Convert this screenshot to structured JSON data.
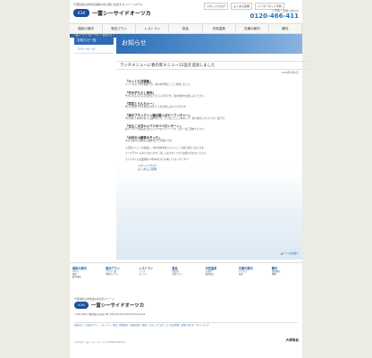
{
  "header": {
    "tagline": "千葉県館山市布良海岸の中心部に位置するリゾートホテル",
    "logo_mark": "ICHI",
    "logo_name": "一富シーサイドオーツカ",
    "links": [
      "スタッフブログ",
      "よくある質問",
      "インターネット予約"
    ],
    "tel_label": "ご予約・お問い合わせ",
    "tel": "0120-466-411"
  },
  "nav": [
    "施設の案内",
    "宿泊プラン",
    "レストラン",
    "宴会",
    "天然温泉",
    "交通の案内",
    "観光"
  ],
  "breadcrumb": "一富シーサイドオーツカ ＞ お知らせ ＞ ランチメニューに春の新メニュー12品を追加しました",
  "sidebar": {
    "active": "お知らせ一覧",
    "item": "フリーページ"
  },
  "hero": {
    "title": "お知らせ"
  },
  "article": {
    "title": "ランチメニューに春の新メニュー12品を追加しました",
    "date": "2014年4月1日",
    "items": [
      {
        "title": "「カットち豆御飯」",
        "desc": "カットち豆で作る御飯です。春のお料理としてご用意しました。"
      },
      {
        "title": "「竹の子ちらし寿司」",
        "desc": "竹の子をふんだんに使用したちらし寿司です。春の味覚をお楽しみください。"
      },
      {
        "title": "「菜花とうんちゃー」",
        "desc": "地元の野菜で作る菜花のおひたしをお楽しみいただけます。"
      },
      {
        "title": "「海のプランクトン麺の酸っぱビーフンチャー」",
        "desc": "海で採れた素材を使った麺料理です。さっぱりとした味わいで、春の食卓にぴったりの一品です。"
      },
      {
        "title": "「仕込こま甘キャベツのペペロンチーノ」",
        "desc": "春キャベツの甘みを活かしたペペロンチーノです。ぜひ一度ご賞味ください。"
      },
      {
        "title": "「木村の小鯵茶のぞっち」",
        "desc": "木村で採れた新鮮な小鯵を使った茶漬けです。"
      }
    ],
    "note1": "上記新メニューの追加に、旬の食材を使ったメニューも取り揃えております。",
    "note2": "テイクアウトも承っております。詳しくはスタッフまでお問い合わせください。",
    "contact": "ランチタイム営業時間 11時30分から14時（ラストオーダー）",
    "links": [
      "スタッフブログ",
      "よくあるご質問"
    ],
    "pagetop": "▲ページの先頭へ"
  },
  "footer": {
    "cols": [
      {
        "title": "施設の案内",
        "subs": [
          "ホテル",
          "客室",
          "館内施設"
        ]
      },
      {
        "title": "宿泊プラン",
        "subs": [
          "プラン一覧",
          "季節のプラン"
        ]
      },
      {
        "title": "レストラン",
        "subs": [
          "ランチ",
          "ディナー"
        ]
      },
      {
        "title": "宴会",
        "subs": [
          "宴会場",
          "宴会プラン"
        ]
      },
      {
        "title": "天然温泉",
        "subs": [
          "大浴場",
          "露天風呂"
        ]
      },
      {
        "title": "交通の案内",
        "subs": [
          "アクセス",
          "送迎"
        ]
      },
      {
        "title": "観光",
        "subs": [
          "周辺観光",
          "体験"
        ]
      }
    ],
    "tagline": "千葉県館山市布良の海辺のリゾート",
    "logo_mark": "ICHI",
    "logo_name": "一富シーサイドオーツカ",
    "address": "〒294-0234 千葉県館山市布良 TEL 0470-29-1111 FAX 0470-29-1112",
    "links": "お知らせ｜ご宿泊プラン｜レストラン｜宴会｜天然温泉｜交通の案内｜観光｜スタッフブログ｜よくある質問｜お問い合わせ｜サイトマップ",
    "copyright": "Copyright 一富シーサイドオーツカ All Rights Reserved.",
    "corp": "大塚商会"
  }
}
